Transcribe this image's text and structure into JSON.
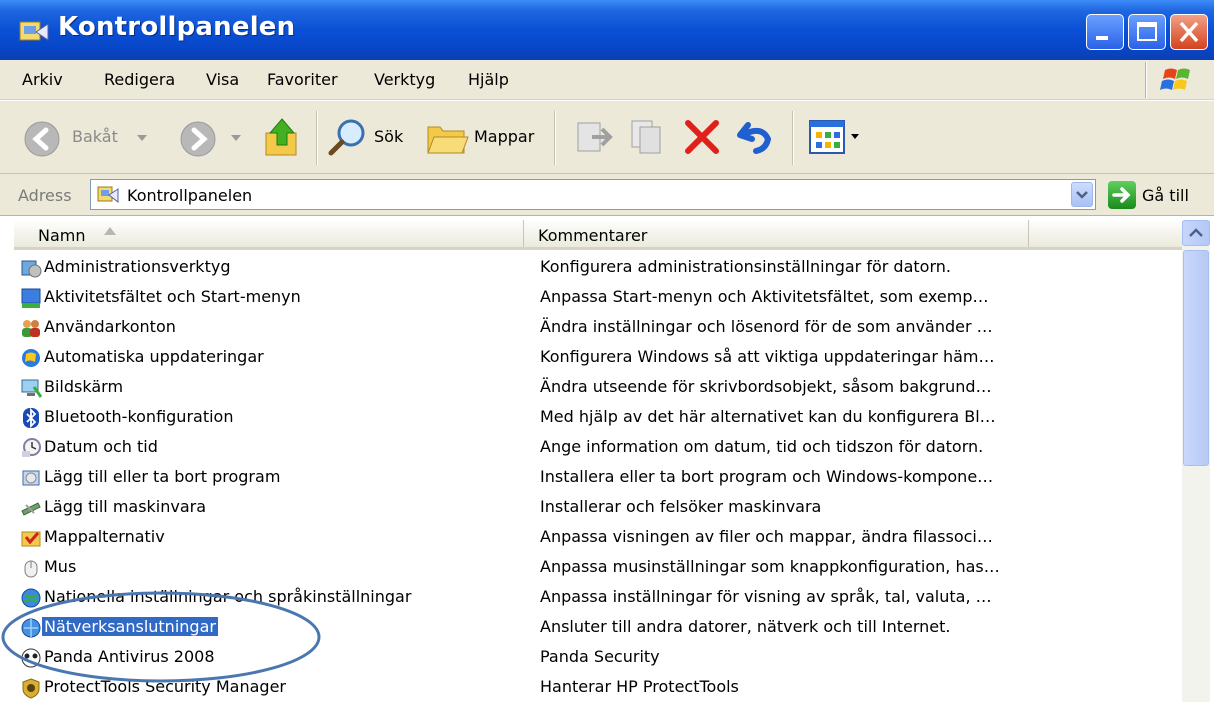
{
  "window": {
    "title": "Kontrollpanelen",
    "colors": {
      "titlebar": "#0a50d5",
      "selection": "#316ac5",
      "annotation": "#4a77b0"
    }
  },
  "menu": [
    "Arkiv",
    "Redigera",
    "Visa",
    "Favoriter",
    "Verktyg",
    "Hjälp"
  ],
  "toolbar": {
    "back_label": "Bakåt",
    "search_label": "Sök",
    "folders_label": "Mappar"
  },
  "address": {
    "label": "Adress",
    "value": "Kontrollpanelen",
    "go_label": "Gå till"
  },
  "list": {
    "columns": [
      "Namn",
      "Kommentarer"
    ],
    "items": [
      {
        "name": "Administrationsverktyg",
        "comment": "Konfigurera administrationsinställningar för datorn.",
        "icon": "admin-tools-icon"
      },
      {
        "name": "Aktivitetsfältet och Start-menyn",
        "comment": "Anpassa Start-menyn och Aktivitetsfältet, som exemp…",
        "icon": "taskbar-icon"
      },
      {
        "name": "Användarkonton",
        "comment": "Ändra inställningar och lösenord för de som använder …",
        "icon": "user-accounts-icon"
      },
      {
        "name": "Automatiska uppdateringar",
        "comment": "Konfigurera Windows så att viktiga uppdateringar häm…",
        "icon": "windows-update-icon"
      },
      {
        "name": "Bildskärm",
        "comment": "Ändra utseende för skrivbordsobjekt, såsom bakgrund…",
        "icon": "display-icon"
      },
      {
        "name": "Bluetooth-konfiguration",
        "comment": "Med hjälp av det här alternativet kan du konfigurera Bl…",
        "icon": "bluetooth-icon"
      },
      {
        "name": "Datum och tid",
        "comment": "Ange information om datum, tid och tidszon för datorn.",
        "icon": "clock-icon"
      },
      {
        "name": "Lägg till eller ta bort program",
        "comment": "Installera eller ta bort program och Windows-kompone…",
        "icon": "add-remove-programs-icon"
      },
      {
        "name": "Lägg till maskinvara",
        "comment": "Installerar och felsöker maskinvara",
        "icon": "hardware-icon"
      },
      {
        "name": "Mappalternativ",
        "comment": "Anpassa visningen av filer och mappar, ändra filassoci…",
        "icon": "folder-options-icon"
      },
      {
        "name": "Mus",
        "comment": "Anpassa musinställningar som knappkonfiguration, has…",
        "icon": "mouse-icon"
      },
      {
        "name": "Nationella inställningar och språkinställningar",
        "comment": "Anpassa inställningar för visning av språk, tal, valuta, …",
        "icon": "globe-icon"
      },
      {
        "name": "Nätverksanslutningar",
        "comment": "Ansluter till andra datorer, nätverk och till Internet.",
        "icon": "network-icon",
        "selected": true
      },
      {
        "name": "Panda Antivirus 2008",
        "comment": "Panda Security",
        "icon": "panda-antivirus-icon"
      },
      {
        "name": "ProtectTools Security Manager",
        "comment": "Hanterar HP ProtectTools",
        "icon": "security-shield-icon"
      }
    ]
  }
}
